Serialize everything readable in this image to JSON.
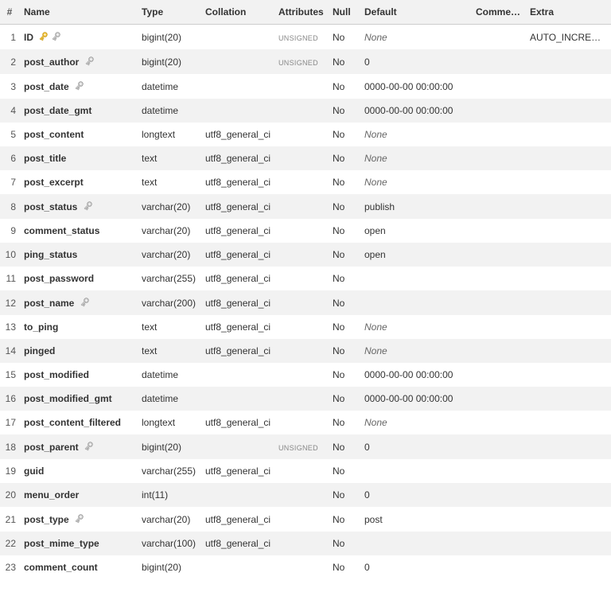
{
  "headers": {
    "num": "#",
    "name": "Name",
    "type": "Type",
    "collation": "Collation",
    "attributes": "Attributes",
    "null": "Null",
    "default": "Default",
    "comments": "Comments",
    "extra": "Extra"
  },
  "rows": [
    {
      "num": "1",
      "name": "ID",
      "primary": true,
      "index": true,
      "type": "bigint(20)",
      "collation": "",
      "attr": "UNSIGNED",
      "null": "No",
      "default": "None",
      "default_italic": true,
      "extra": "AUTO_INCREMENT"
    },
    {
      "num": "2",
      "name": "post_author",
      "primary": false,
      "index": true,
      "type": "bigint(20)",
      "collation": "",
      "attr": "UNSIGNED",
      "null": "No",
      "default": "0",
      "default_italic": false,
      "extra": ""
    },
    {
      "num": "3",
      "name": "post_date",
      "primary": false,
      "index": true,
      "type": "datetime",
      "collation": "",
      "attr": "",
      "null": "No",
      "default": "0000-00-00 00:00:00",
      "default_italic": false,
      "extra": ""
    },
    {
      "num": "4",
      "name": "post_date_gmt",
      "primary": false,
      "index": false,
      "type": "datetime",
      "collation": "",
      "attr": "",
      "null": "No",
      "default": "0000-00-00 00:00:00",
      "default_italic": false,
      "extra": ""
    },
    {
      "num": "5",
      "name": "post_content",
      "primary": false,
      "index": false,
      "type": "longtext",
      "collation": "utf8_general_ci",
      "attr": "",
      "null": "No",
      "default": "None",
      "default_italic": true,
      "extra": ""
    },
    {
      "num": "6",
      "name": "post_title",
      "primary": false,
      "index": false,
      "type": "text",
      "collation": "utf8_general_ci",
      "attr": "",
      "null": "No",
      "default": "None",
      "default_italic": true,
      "extra": ""
    },
    {
      "num": "7",
      "name": "post_excerpt",
      "primary": false,
      "index": false,
      "type": "text",
      "collation": "utf8_general_ci",
      "attr": "",
      "null": "No",
      "default": "None",
      "default_italic": true,
      "extra": ""
    },
    {
      "num": "8",
      "name": "post_status",
      "primary": false,
      "index": true,
      "type": "varchar(20)",
      "collation": "utf8_general_ci",
      "attr": "",
      "null": "No",
      "default": "publish",
      "default_italic": false,
      "extra": ""
    },
    {
      "num": "9",
      "name": "comment_status",
      "primary": false,
      "index": false,
      "type": "varchar(20)",
      "collation": "utf8_general_ci",
      "attr": "",
      "null": "No",
      "default": "open",
      "default_italic": false,
      "extra": ""
    },
    {
      "num": "10",
      "name": "ping_status",
      "primary": false,
      "index": false,
      "type": "varchar(20)",
      "collation": "utf8_general_ci",
      "attr": "",
      "null": "No",
      "default": "open",
      "default_italic": false,
      "extra": ""
    },
    {
      "num": "11",
      "name": "post_password",
      "primary": false,
      "index": false,
      "type": "varchar(255)",
      "collation": "utf8_general_ci",
      "attr": "",
      "null": "No",
      "default": "",
      "default_italic": false,
      "extra": ""
    },
    {
      "num": "12",
      "name": "post_name",
      "primary": false,
      "index": true,
      "type": "varchar(200)",
      "collation": "utf8_general_ci",
      "attr": "",
      "null": "No",
      "default": "",
      "default_italic": false,
      "extra": ""
    },
    {
      "num": "13",
      "name": "to_ping",
      "primary": false,
      "index": false,
      "type": "text",
      "collation": "utf8_general_ci",
      "attr": "",
      "null": "No",
      "default": "None",
      "default_italic": true,
      "extra": ""
    },
    {
      "num": "14",
      "name": "pinged",
      "primary": false,
      "index": false,
      "type": "text",
      "collation": "utf8_general_ci",
      "attr": "",
      "null": "No",
      "default": "None",
      "default_italic": true,
      "extra": ""
    },
    {
      "num": "15",
      "name": "post_modified",
      "primary": false,
      "index": false,
      "type": "datetime",
      "collation": "",
      "attr": "",
      "null": "No",
      "default": "0000-00-00 00:00:00",
      "default_italic": false,
      "extra": ""
    },
    {
      "num": "16",
      "name": "post_modified_gmt",
      "primary": false,
      "index": false,
      "type": "datetime",
      "collation": "",
      "attr": "",
      "null": "No",
      "default": "0000-00-00 00:00:00",
      "default_italic": false,
      "extra": ""
    },
    {
      "num": "17",
      "name": "post_content_filtered",
      "primary": false,
      "index": false,
      "type": "longtext",
      "collation": "utf8_general_ci",
      "attr": "",
      "null": "No",
      "default": "None",
      "default_italic": true,
      "extra": ""
    },
    {
      "num": "18",
      "name": "post_parent",
      "primary": false,
      "index": true,
      "type": "bigint(20)",
      "collation": "",
      "attr": "UNSIGNED",
      "null": "No",
      "default": "0",
      "default_italic": false,
      "extra": ""
    },
    {
      "num": "19",
      "name": "guid",
      "primary": false,
      "index": false,
      "type": "varchar(255)",
      "collation": "utf8_general_ci",
      "attr": "",
      "null": "No",
      "default": "",
      "default_italic": false,
      "extra": ""
    },
    {
      "num": "20",
      "name": "menu_order",
      "primary": false,
      "index": false,
      "type": "int(11)",
      "collation": "",
      "attr": "",
      "null": "No",
      "default": "0",
      "default_italic": false,
      "extra": ""
    },
    {
      "num": "21",
      "name": "post_type",
      "primary": false,
      "index": true,
      "type": "varchar(20)",
      "collation": "utf8_general_ci",
      "attr": "",
      "null": "No",
      "default": "post",
      "default_italic": false,
      "extra": ""
    },
    {
      "num": "22",
      "name": "post_mime_type",
      "primary": false,
      "index": false,
      "type": "varchar(100)",
      "collation": "utf8_general_ci",
      "attr": "",
      "null": "No",
      "default": "",
      "default_italic": false,
      "extra": ""
    },
    {
      "num": "23",
      "name": "comment_count",
      "primary": false,
      "index": false,
      "type": "bigint(20)",
      "collation": "",
      "attr": "",
      "null": "No",
      "default": "0",
      "default_italic": false,
      "extra": ""
    }
  ]
}
